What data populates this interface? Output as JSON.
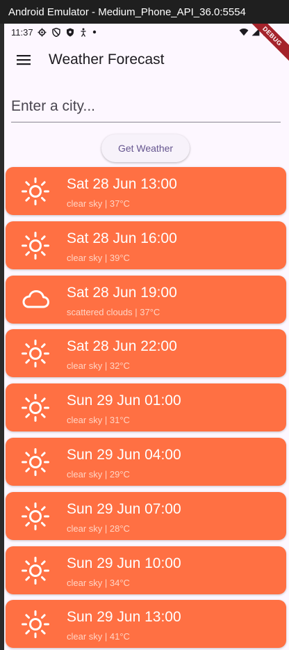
{
  "window": {
    "title": "Android Emulator - Medium_Phone_API_36.0:5554"
  },
  "status_bar": {
    "time": "11:37",
    "left_icons": [
      "settings-icon",
      "shield-icon",
      "play-protect-icon",
      "accessibility-icon",
      "dot-icon"
    ],
    "right_icons": [
      "wifi-icon",
      "signal-icon",
      "battery-icon"
    ]
  },
  "debug_banner": "DEBUG",
  "app_bar": {
    "title": "Weather Forecast",
    "menu_icon": "hamburger-menu-icon"
  },
  "search": {
    "placeholder": "Enter a city...",
    "value": ""
  },
  "get_weather_button": {
    "label": "Get Weather"
  },
  "forecast": [
    {
      "title": "Sat 28 Jun 13:00",
      "subtitle": "clear sky | 37°C",
      "icon": "sun-icon"
    },
    {
      "title": "Sat 28 Jun 16:00",
      "subtitle": "clear sky | 39°C",
      "icon": "sun-icon"
    },
    {
      "title": "Sat 28 Jun 19:00",
      "subtitle": "scattered clouds | 37°C",
      "icon": "cloud-icon"
    },
    {
      "title": "Sat 28 Jun 22:00",
      "subtitle": "clear sky | 32°C",
      "icon": "sun-icon"
    },
    {
      "title": "Sun 29 Jun 01:00",
      "subtitle": "clear sky | 31°C",
      "icon": "sun-icon"
    },
    {
      "title": "Sun 29 Jun 04:00",
      "subtitle": "clear sky | 29°C",
      "icon": "sun-icon"
    },
    {
      "title": "Sun 29 Jun 07:00",
      "subtitle": "clear sky | 28°C",
      "icon": "sun-icon"
    },
    {
      "title": "Sun 29 Jun 10:00",
      "subtitle": "clear sky | 34°C",
      "icon": "sun-icon"
    },
    {
      "title": "Sun 29 Jun 13:00",
      "subtitle": "clear sky | 41°C",
      "icon": "sun-icon"
    }
  ],
  "colors": {
    "card": "#ff7043",
    "background": "#fdf7ff",
    "button_text": "#65558f",
    "subtitle": "#ffd4c4"
  }
}
